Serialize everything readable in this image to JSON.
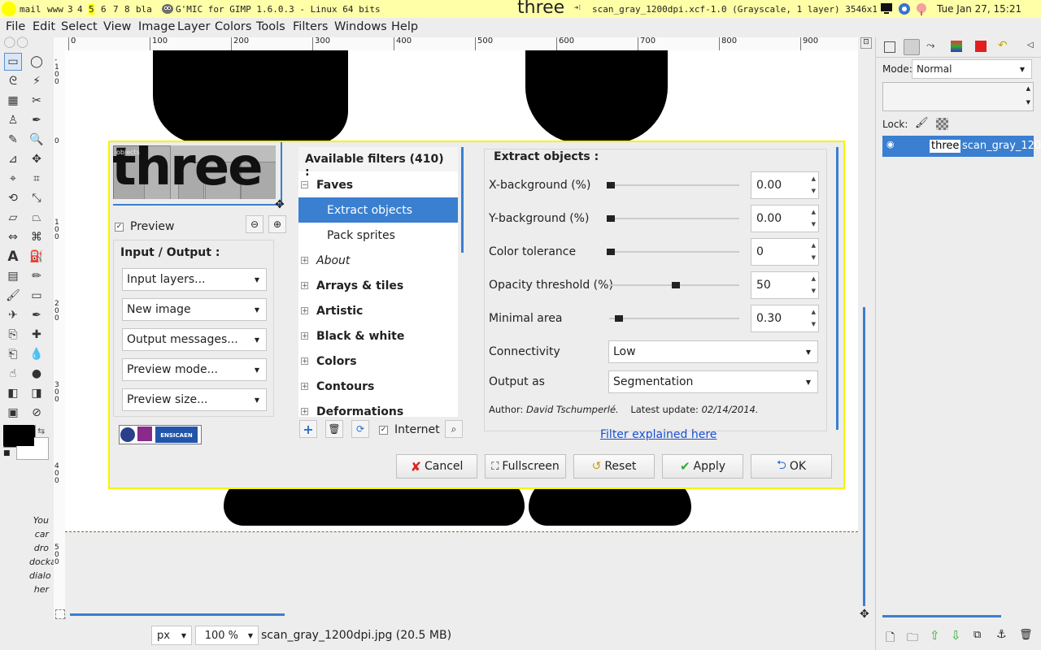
{
  "topbar": {
    "workspaces": [
      "mail",
      "www",
      "3",
      "4",
      "5",
      "6",
      "7",
      "8",
      "bla"
    ],
    "active_workspace": "5",
    "window_title": "G'MIC for GIMP 1.6.0.3 - Linux 64 bits",
    "three_label": "three",
    "image_title": "scan_gray_1200dpi.xcf-1.0 (Grayscale, 1 layer) 3546x1185 …",
    "clock": "Tue Jan 27, 15:21"
  },
  "menubar": [
    "File",
    "Edit",
    "Select",
    "View",
    "Image",
    "Layer",
    "Colors",
    "Tools",
    "Filters",
    "Windows",
    "Help"
  ],
  "ruler": {
    "h_ticks": [
      "0",
      "100",
      "200",
      "300",
      "400",
      "500",
      "600",
      "700",
      "800",
      "900"
    ],
    "v_ticks": [
      "-100",
      "0",
      "100",
      "200",
      "300",
      "400",
      "500"
    ]
  },
  "toolbox_hint": [
    "You",
    "car",
    "dro",
    "docka",
    "dialo",
    "her"
  ],
  "status": {
    "unit": "px",
    "zoom": "100 %",
    "file_info": "scan_gray_1200dpi.jpg (20.5 MB)"
  },
  "dock": {
    "mode_label": "Mode:",
    "mode_value": "Normal",
    "lock_label": "Lock:",
    "layer_thumb_text": "three",
    "layer_name": "scan_gray_120"
  },
  "gmic": {
    "preview_overlay": "objects",
    "preview_word": "three",
    "preview_checkbox_label": "Preview",
    "io_title": "Input / Output :",
    "io_combos": [
      "Input layers...",
      "New image",
      "Output messages...",
      "Preview mode...",
      "Preview size..."
    ],
    "logo_text": "ENSICAEN",
    "filters_header": "Available filters (410) :",
    "tree": [
      {
        "label": "Faves",
        "type": "folder-open",
        "bold": true
      },
      {
        "label": "Extract objects",
        "type": "leaf",
        "selected": true
      },
      {
        "label": "Pack sprites",
        "type": "leaf"
      },
      {
        "label": "About",
        "type": "folder",
        "italic": true
      },
      {
        "label": "Arrays & tiles",
        "type": "folder",
        "bold": true
      },
      {
        "label": "Artistic",
        "type": "folder",
        "bold": true
      },
      {
        "label": "Black & white",
        "type": "folder",
        "bold": true
      },
      {
        "label": "Colors",
        "type": "folder",
        "bold": true
      },
      {
        "label": "Contours",
        "type": "folder",
        "bold": true
      },
      {
        "label": "Deformations",
        "type": "folder",
        "bold": true
      }
    ],
    "internet_label": "Internet",
    "filter_title": "Extract objects :",
    "params": [
      {
        "label": "X-background (%)",
        "value": "0.00",
        "level": 0.0,
        "spin": true
      },
      {
        "label": "Y-background (%)",
        "value": "0.00",
        "level": 0.0,
        "spin": true
      },
      {
        "label": "Color tolerance",
        "value": "0",
        "level": 0.0,
        "spin": true
      },
      {
        "label": "Opacity threshold (%)",
        "value": "50",
        "level": 0.5,
        "spin": true
      },
      {
        "label": "Minimal area",
        "value": "0.30",
        "level": 0.06,
        "spin": true
      }
    ],
    "selects": [
      {
        "label": "Connectivity",
        "value": "Low"
      },
      {
        "label": "Output as",
        "value": "Segmentation"
      }
    ],
    "author_prefix": "Author:",
    "author": "David Tschumperlé.",
    "update_prefix": "Latest update:",
    "update_date": "02/14/2014.",
    "explained_link": "Filter explained here",
    "buttons": {
      "cancel": "Cancel",
      "fullscreen": "Fullscreen",
      "reset": "Reset",
      "apply": "Apply",
      "ok": "OK"
    }
  }
}
